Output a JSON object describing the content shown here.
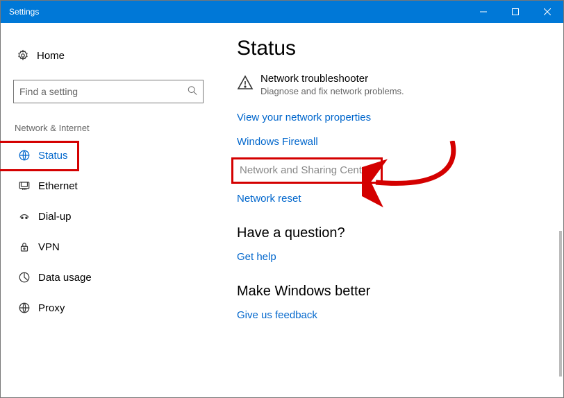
{
  "window": {
    "title": "Settings"
  },
  "sidebar": {
    "home_label": "Home",
    "search_placeholder": "Find a setting",
    "category_label": "Network & Internet",
    "items": [
      {
        "label": "Status",
        "selected": true
      },
      {
        "label": "Ethernet",
        "selected": false
      },
      {
        "label": "Dial-up",
        "selected": false
      },
      {
        "label": "VPN",
        "selected": false
      },
      {
        "label": "Data usage",
        "selected": false
      },
      {
        "label": "Proxy",
        "selected": false
      }
    ]
  },
  "main": {
    "title": "Status",
    "troubleshooter": {
      "title": "Network troubleshooter",
      "subtitle": "Diagnose and fix network problems."
    },
    "links": {
      "view_properties": "View your network properties",
      "firewall": "Windows Firewall",
      "sharing_center": "Network and Sharing Center",
      "reset": "Network reset"
    },
    "question": {
      "heading": "Have a question?",
      "link": "Get help"
    },
    "feedback": {
      "heading": "Make Windows better",
      "link": "Give us feedback"
    }
  },
  "annotations": {
    "highlight_nav_item": "Status",
    "highlight_link": "Network and Sharing Center"
  }
}
